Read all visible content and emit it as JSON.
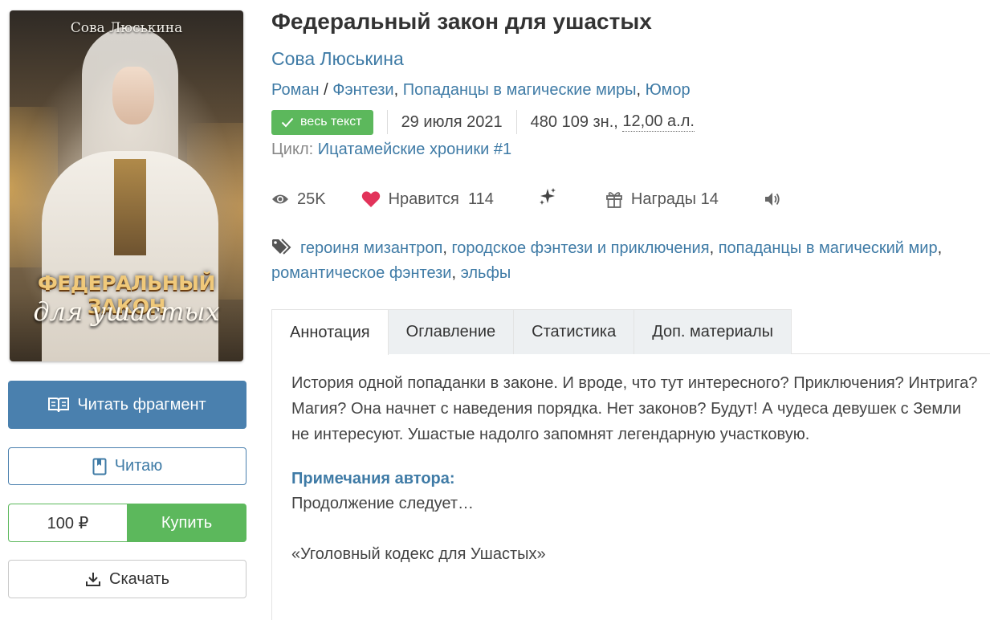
{
  "cover": {
    "author_text": "Сова Люськина",
    "title_line1": "ФЕДЕРАЛЬНЫЙ ЗАКОН",
    "title_line2": "для ушастых"
  },
  "actions": {
    "read_fragment": "Читать фрагмент",
    "reading": "Читаю",
    "price": "100 ₽",
    "buy": "Купить",
    "download": "Скачать"
  },
  "book": {
    "title": "Федеральный закон для ушастых",
    "author": "Сова Люськина",
    "genre_main": "Роман",
    "genre_sep": " / ",
    "genres": [
      "Фэнтези",
      "Попаданцы в магические миры",
      "Юмор"
    ],
    "status_badge": "весь текст",
    "date": "29 июля 2021",
    "chars": "480 109 зн.,",
    "sheets": "12,00",
    "sheets_unit": "а.л.",
    "cycle_label": "Цикл:",
    "cycle_name": "Ицатамейские хроники #1"
  },
  "stats": {
    "views": "25K",
    "likes_label": "Нравится",
    "likes_count": "114",
    "awards_label": "Награды",
    "awards_count": "14"
  },
  "tags": [
    "героиня мизантроп",
    "городское фэнтези и приключения",
    "попаданцы в магический мир",
    "романтическое фэнтези",
    "эльфы"
  ],
  "tabs": [
    "Аннотация",
    "Оглавление",
    "Статистика",
    "Доп. материалы"
  ],
  "annotation": "История одной попаданки в законе. И вроде, что тут интересного? Приключения? Интрига? Магия? Она начнет с наведения порядка. Нет законов? Будут! А чудеса девушек с Земли не интересуют. Ушастые надолго запомнят легендарную участковую.",
  "notes": {
    "heading": "Примечания автора:",
    "line1": "Продолжение следует…",
    "line2": "«Уголовный кодекс для Ушастых»"
  },
  "colors": {
    "link": "#3f7ba6",
    "primary_button": "#4a80ae",
    "success": "#5cb85c",
    "heart": "#e2335a"
  }
}
